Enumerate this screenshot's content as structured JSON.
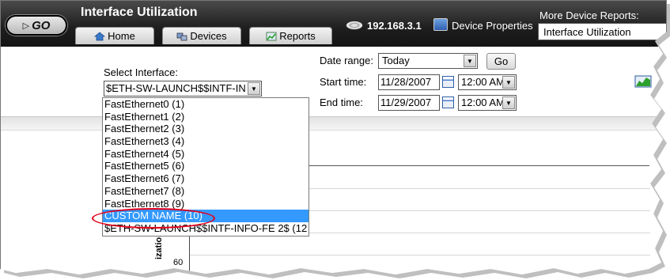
{
  "header": {
    "go_label": "GO",
    "app_title": "Interface Utilization",
    "tabs": [
      {
        "label": "Home",
        "icon": "home-icon"
      },
      {
        "label": "Devices",
        "icon": "devices-icon"
      },
      {
        "label": "Reports",
        "icon": "reports-icon"
      }
    ],
    "ip_address": "192.168.3.1",
    "device_properties_label": "Device Properties",
    "more_reports_label": "More Device Reports:",
    "more_reports_value": "Interface Utilization"
  },
  "filters": {
    "select_interface_label": "Select Interface:",
    "selected_interface": "$ETH-SW-LAUNCH$$INTF-IN",
    "date_range_label": "Date range:",
    "date_range_value": "Today",
    "go_label": "Go",
    "start_label": "Start time:",
    "start_date": "11/28/2007",
    "start_time": "12:00 AM",
    "end_label": "End time:",
    "end_date": "11/29/2007",
    "end_time": "12:00 AM"
  },
  "interface_list": [
    "FastEthernet0 (1)",
    "FastEthernet1 (2)",
    "FastEthernet2 (3)",
    "FastEthernet3 (4)",
    "FastEthernet4 (5)",
    "FastEthernet5 (6)",
    "FastEthernet6 (7)",
    "FastEthernet7 (8)",
    "FastEthernet8 (9)",
    "CUSTOM NAME (10)",
    "$ETH-SW-LAUNCH$$INTF-INFO-FE 2$ (12"
  ],
  "selected_list_index": 9,
  "chart": {
    "y_axis_title": "ization",
    "y_tick": "60"
  },
  "colors": {
    "header_bg": "#1e1e1e",
    "selection": "#3399ff",
    "annotation_red": "#e3001b"
  }
}
